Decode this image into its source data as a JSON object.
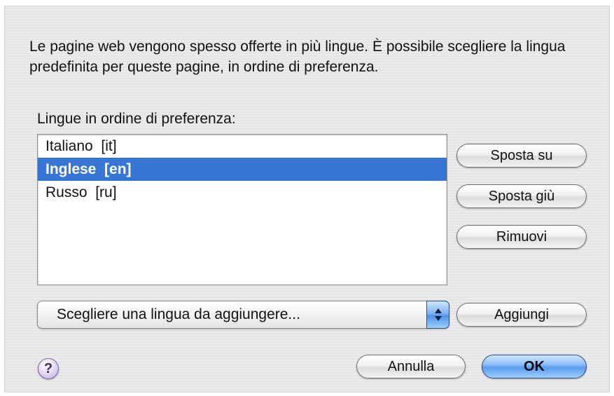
{
  "dialog": {
    "description": "Le pagine web vengono spesso offerte in più lingue. È possibile scegliere la lingua predefinita per queste pagine, in ordine di preferenza.",
    "list_label": "Lingue in ordine di preferenza:",
    "languages": [
      {
        "label": "Italiano  [it]",
        "selected": false
      },
      {
        "label": "Inglese  [en]",
        "selected": true
      },
      {
        "label": "Russo  [ru]",
        "selected": false
      }
    ],
    "buttons": {
      "move_up": "Sposta su",
      "move_down": "Sposta giù",
      "remove": "Rimuovi",
      "add": "Aggiungi",
      "cancel": "Annulla",
      "ok": "OK"
    },
    "popup": {
      "selected": "Scegliere una lingua da aggiungere..."
    },
    "help_icon": "question-mark-icon",
    "colors": {
      "selection": "#3876d6",
      "default_button": "#5a9cf0"
    }
  }
}
